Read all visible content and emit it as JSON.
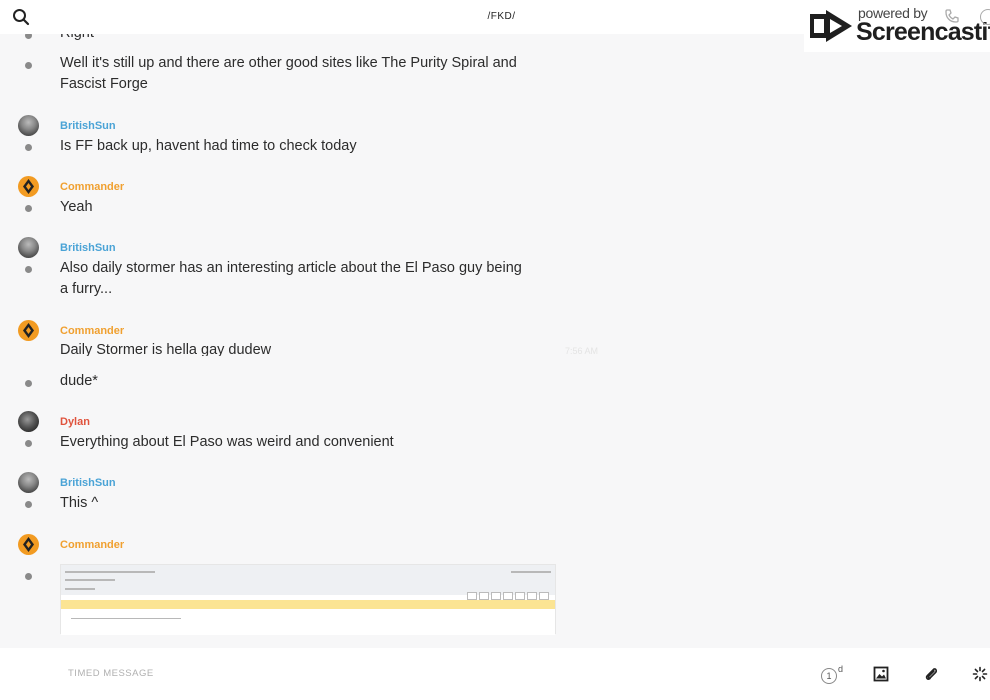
{
  "header": {
    "channel_title": "/FKD/",
    "search_icon": "search-icon"
  },
  "watermark": {
    "line1": "powered by",
    "line2": "Screencastify"
  },
  "messages": [
    {
      "author": "",
      "lines": [
        "Right"
      ]
    },
    {
      "author": "",
      "lines": [
        "Well it's still up and there are other good sites like The Purity Spiral and Fascist Forge"
      ]
    },
    {
      "author": "BritishSun",
      "lines": [
        "Is FF back up, havent had time to check today"
      ]
    },
    {
      "author": "Commander",
      "lines": [
        "Yeah"
      ]
    },
    {
      "author": "BritishSun",
      "lines": [
        "Also daily stormer has an interesting article about the El Paso guy being a furry..."
      ]
    },
    {
      "author": "Commander",
      "lines": [
        "Daily Stormer is hella gay dudew",
        "dude*"
      ],
      "timestamp": "7:56 AM"
    },
    {
      "author": "Dylan",
      "lines": [
        "Everything about El Paso was weird and convenient"
      ]
    },
    {
      "author": "BritishSun",
      "lines": [
        "This ^"
      ]
    },
    {
      "author": "Commander",
      "lines": [],
      "attachment": "image"
    }
  ],
  "composer": {
    "placeholder": "TIMED MESSAGE",
    "timer_value": "1",
    "timer_unit": "d",
    "icons": [
      "image-icon",
      "paperclip-icon",
      "loading-icon"
    ]
  },
  "colors": {
    "author_britishsun": "#4aa3d6",
    "author_commander": "#f0a030",
    "author_dylan": "#e0533d"
  }
}
